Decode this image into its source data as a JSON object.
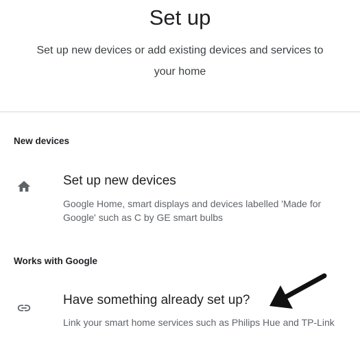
{
  "header": {
    "title": "Set up",
    "subtitle": "Set up new devices or add existing devices and services to your home"
  },
  "sections": [
    {
      "heading": "New devices",
      "item": {
        "icon": "home-icon",
        "title": "Set up new devices",
        "description": "Google Home, smart displays and devices labelled 'Made for Google' such as C by GE smart bulbs"
      }
    },
    {
      "heading": "Works with Google",
      "item": {
        "icon": "link-icon",
        "title": "Have something already set up?",
        "description": "Link your smart home services such as Philips Hue and TP-Link"
      }
    }
  ],
  "annotation": {
    "icon": "pointing-arrow-icon",
    "color": "#111111"
  },
  "colors": {
    "text_primary": "#202124",
    "text_secondary": "#5f6368",
    "icon": "#5f6368",
    "divider": "#e8eaed"
  }
}
